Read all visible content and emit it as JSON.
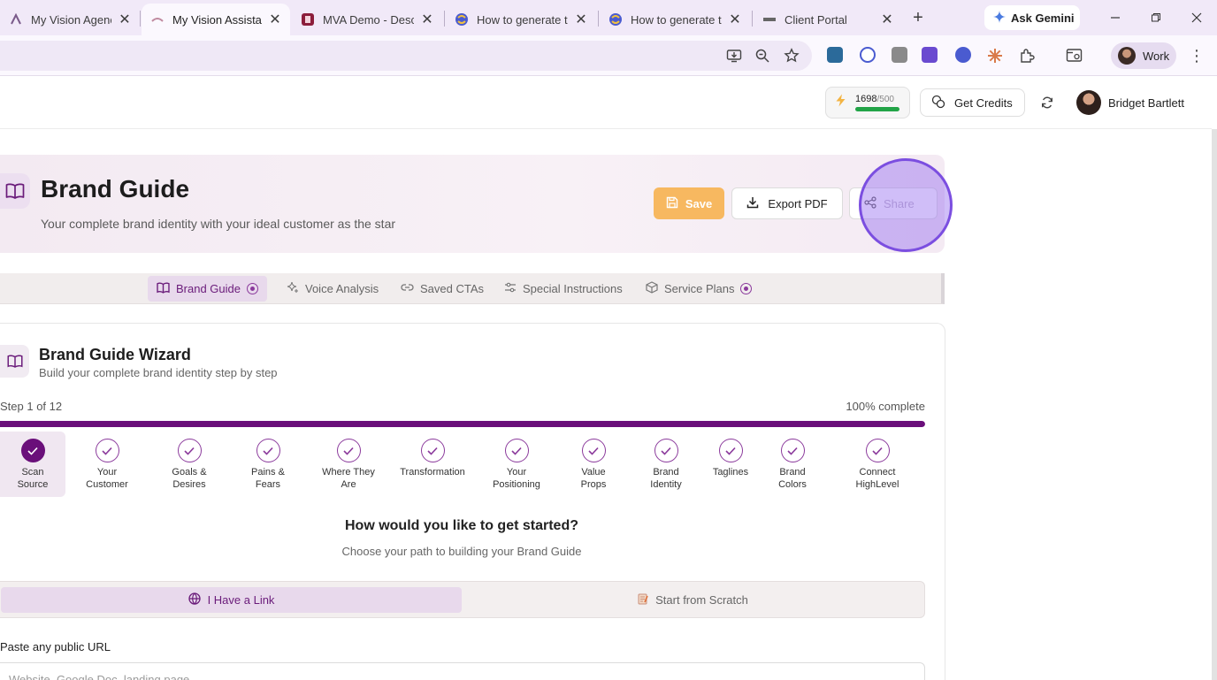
{
  "browser": {
    "tabs": [
      {
        "title": "My Vision Agency™",
        "favicon": "mva-icon",
        "active": false
      },
      {
        "title": "My Vision Assistant",
        "favicon": "mva-icon",
        "active": true
      },
      {
        "title": "MVA Demo - Descri",
        "favicon": "descript-icon",
        "active": false
      },
      {
        "title": "How to generate ti",
        "favicon": "extension-icon",
        "active": false
      },
      {
        "title": "How to generate ti",
        "favicon": "extension-icon",
        "active": false
      },
      {
        "title": "Client Portal",
        "favicon": "portal-icon",
        "active": false
      }
    ],
    "gemini_label": "Ask Gemini",
    "profile_label": "Work"
  },
  "header": {
    "credits_used": "1698",
    "credits_total": "/500",
    "get_credits_label": "Get Credits",
    "user_name": "Bridget Bartlett"
  },
  "hero": {
    "title": "Brand Guide",
    "subtitle": "Your complete brand identity with your ideal customer as the star",
    "save_label": "Save",
    "export_label": "Export PDF",
    "share_label": "Share"
  },
  "subtabs": [
    {
      "label": "Brand Guide",
      "active": true
    },
    {
      "label": "Voice Analysis",
      "active": false
    },
    {
      "label": "Saved CTAs",
      "active": false
    },
    {
      "label": "Special Instructions",
      "active": false
    },
    {
      "label": "Service Plans",
      "active": false
    }
  ],
  "wizard": {
    "title": "Brand Guide Wizard",
    "subtitle": "Build your complete brand identity step by step",
    "step_text": "Step 1 of 12",
    "percent_text": "100% complete",
    "progress": 1.0,
    "steps": [
      {
        "line1": "Scan",
        "line2": "Source",
        "current": true
      },
      {
        "line1": "Your",
        "line2": "Customer",
        "current": false
      },
      {
        "line1": "Goals &",
        "line2": "Desires",
        "current": false
      },
      {
        "line1": "Pains &",
        "line2": "Fears",
        "current": false
      },
      {
        "line1": "Where They",
        "line2": "Are",
        "current": false
      },
      {
        "line1": "Transformation",
        "line2": "",
        "current": false
      },
      {
        "line1": "Your",
        "line2": "Positioning",
        "current": false
      },
      {
        "line1": "Value",
        "line2": "Props",
        "current": false
      },
      {
        "line1": "Brand",
        "line2": "Identity",
        "current": false
      },
      {
        "line1": "Taglines",
        "line2": "",
        "current": false
      },
      {
        "line1": "Brand",
        "line2": "Colors",
        "current": false
      },
      {
        "line1": "Connect",
        "line2": "HighLevel",
        "current": false
      }
    ],
    "question_title": "How would you like to get started?",
    "question_subtitle": "Choose your path to building your Brand Guide",
    "choices": [
      {
        "label": "I Have a Link",
        "active": true
      },
      {
        "label": "Start from Scratch",
        "active": false
      }
    ],
    "url_label": "Paste any public URL",
    "url_placeholder": "Website, Google Doc, landing page..."
  },
  "colors": {
    "accent": "#6a0f7a",
    "save_button": "#f7b860",
    "credit_bar": "#22a447"
  }
}
